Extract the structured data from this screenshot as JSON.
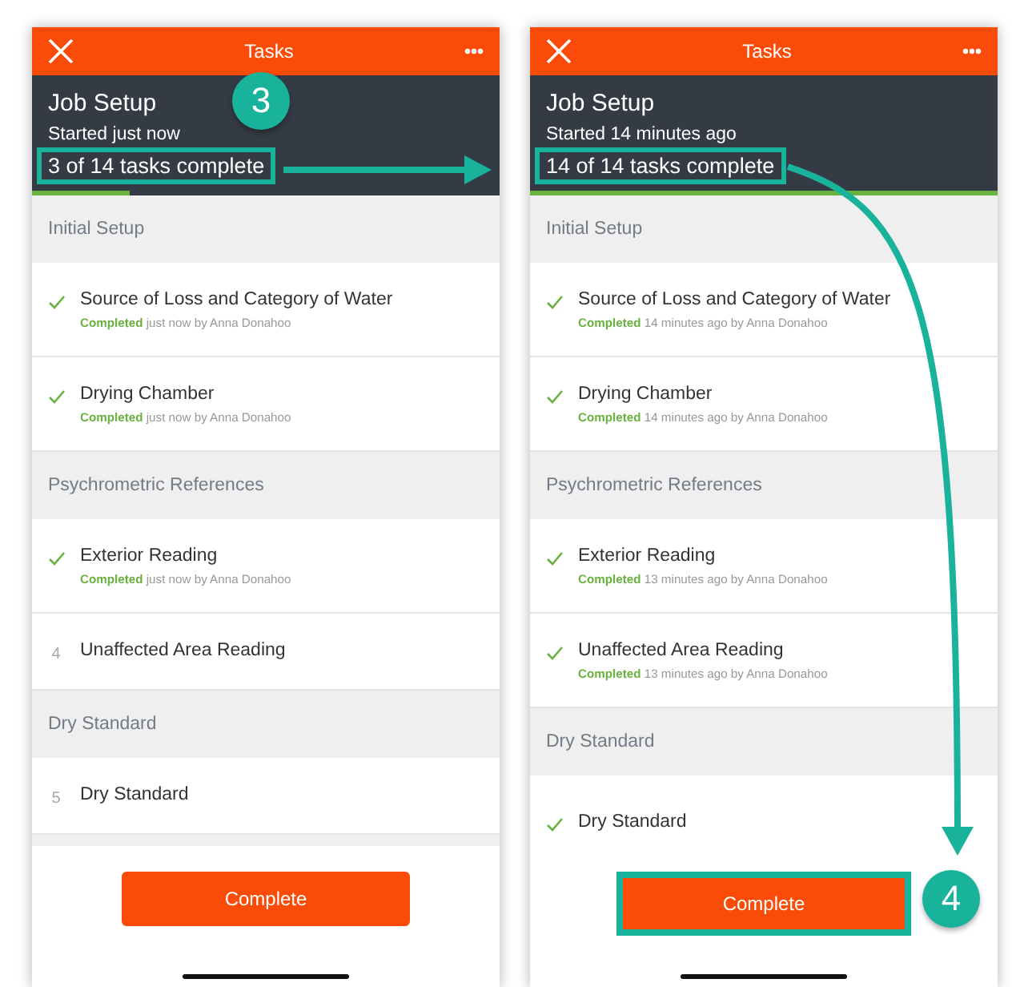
{
  "screens": [
    {
      "title": "Tasks",
      "job_title": "Job Setup",
      "started": "Started just now",
      "progress": "3 of 14 tasks complete",
      "progress_highlighted": true,
      "level": 0.21,
      "step_badge": "3",
      "button": "Complete",
      "button_highlighted": false,
      "sections": [
        {
          "title": "Initial Setup",
          "tasks": [
            {
              "name": "Source of Loss and Category of Water",
              "done": true,
              "status": "Completed",
              "detail": "just now by Anna Donahoo"
            },
            {
              "name": "Drying Chamber",
              "done": true,
              "status": "Completed",
              "detail": "just now by Anna Donahoo"
            }
          ]
        },
        {
          "title": "Psychrometric References",
          "tasks": [
            {
              "name": "Exterior Reading",
              "done": true,
              "status": "Completed",
              "detail": "just now by Anna Donahoo"
            },
            {
              "name": "Unaffected Area Reading",
              "done": false,
              "number": "4"
            }
          ]
        },
        {
          "title": "Dry Standard",
          "tasks": [
            {
              "name": "Dry Standard",
              "done": false,
              "number": "5"
            }
          ]
        }
      ]
    },
    {
      "title": "Tasks",
      "job_title": "Job Setup",
      "started": "Started 14 minutes ago",
      "progress": "14 of 14 tasks complete",
      "progress_highlighted": true,
      "level": 1,
      "step_badge": "4",
      "button": "Complete",
      "button_highlighted": true,
      "sections": [
        {
          "title": "Initial Setup",
          "tasks": [
            {
              "name": "Source of Loss and Category of Water",
              "done": true,
              "status": "Completed",
              "detail": "14 minutes ago by Anna Donahoo"
            },
            {
              "name": "Drying Chamber",
              "done": true,
              "status": "Completed",
              "detail": "14 minutes ago by Anna Donahoo"
            }
          ]
        },
        {
          "title": "Psychrometric References",
          "tasks": [
            {
              "name": "Exterior Reading",
              "done": true,
              "status": "Completed",
              "detail": "13 minutes ago by Anna Donahoo"
            },
            {
              "name": "Unaffected Area Reading",
              "done": true,
              "status": "Completed",
              "detail": "13 minutes ago by Anna Donahoo"
            }
          ]
        },
        {
          "title": "Dry Standard",
          "tasks": [
            {
              "name": "Dry Standard",
              "done": true
            }
          ]
        }
      ]
    }
  ]
}
